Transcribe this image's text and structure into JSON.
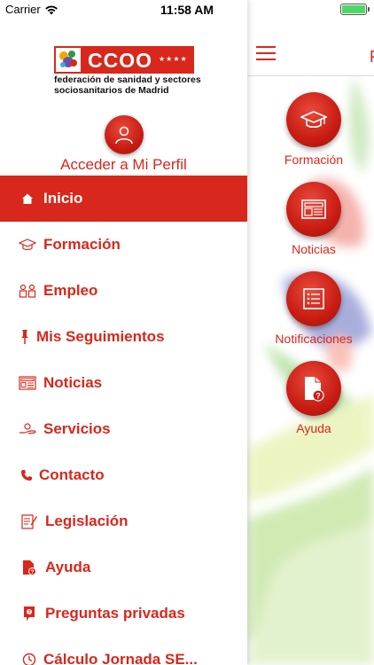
{
  "status_bar": {
    "carrier": "Carrier",
    "time": "11:58 AM"
  },
  "logo": {
    "wordmark": "CCOO",
    "stars": "★★★★",
    "line1": "federación de sanidad y sectores",
    "line2": "sociosanitarios de Madrid"
  },
  "profile": {
    "label": "Acceder a Mi Perfil"
  },
  "menu": {
    "items": [
      {
        "label": "Inicio",
        "icon": "home-icon",
        "active": true
      },
      {
        "label": "Formación",
        "icon": "graduation-cap-icon"
      },
      {
        "label": "Empleo",
        "icon": "people-icon"
      },
      {
        "label": "Mis Seguimientos",
        "icon": "pin-icon"
      },
      {
        "label": "Noticias",
        "icon": "newspaper-icon"
      },
      {
        "label": "Servicios",
        "icon": "hand-icon"
      },
      {
        "label": "Contacto",
        "icon": "phone-icon"
      },
      {
        "label": "Legislación",
        "icon": "document-edit-icon"
      },
      {
        "label": "Ayuda",
        "icon": "help-document-icon"
      },
      {
        "label": "Preguntas privadas",
        "icon": "question-bubble-icon"
      },
      {
        "label": "Cálculo Jornada SE...",
        "icon": "clock-icon"
      }
    ]
  },
  "main": {
    "title_initial": "F",
    "tiles": [
      {
        "label": "Formación",
        "icon": "graduation-cap-icon"
      },
      {
        "label": "Noticias",
        "icon": "newspaper-icon"
      },
      {
        "label": "Notificaciones",
        "icon": "list-icon"
      },
      {
        "label": "Ayuda",
        "icon": "help-document-icon"
      }
    ]
  },
  "colors": {
    "brand_red": "#d8271c",
    "battery_green": "#4cd964"
  }
}
